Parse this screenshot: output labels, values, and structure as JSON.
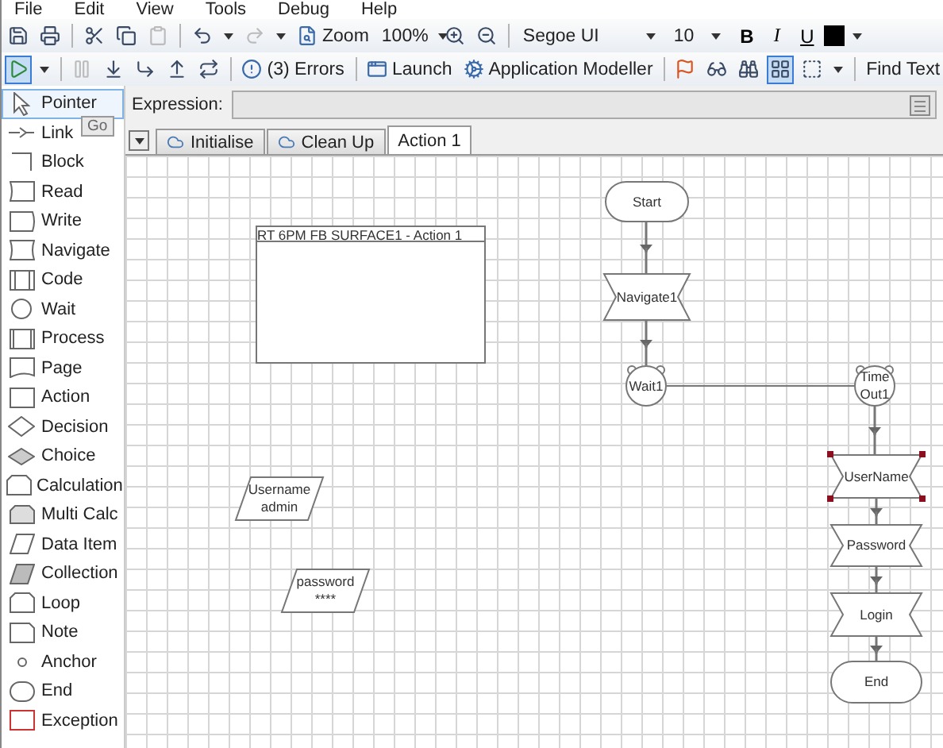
{
  "menu": [
    "File",
    "Edit",
    "View",
    "Tools",
    "Debug",
    "Help"
  ],
  "toolbar_1": [
    {
      "kind": "icon",
      "disabled": false
    },
    {
      "kind": "icon",
      "disabled": false
    },
    {
      "kind": "sep"
    },
    {
      "kind": "icon",
      "disabled": false
    },
    {
      "kind": "icon",
      "disabled": false
    },
    {
      "kind": "icon",
      "disabled": true
    },
    {
      "kind": "sep"
    },
    {
      "kind": "icon",
      "disabled": false
    },
    {
      "kind": "caret"
    },
    {
      "kind": "icon",
      "disabled": true
    },
    {
      "kind": "caret"
    },
    {
      "kind": "button",
      "label": "Zoom"
    },
    {
      "kind": "combo",
      "value": "100%"
    },
    {
      "kind": "icon",
      "disabled": false
    },
    {
      "kind": "icon",
      "disabled": false
    },
    {
      "kind": "sep"
    },
    {
      "kind": "combo",
      "value": "Segoe UI"
    },
    {
      "kind": "combo",
      "value": "10"
    },
    {
      "kind": "text",
      "label": "B"
    },
    {
      "kind": "text",
      "label": "I"
    },
    {
      "kind": "text",
      "label": "U"
    },
    {
      "kind": "swatch",
      "color": "#000000"
    },
    {
      "kind": "caret"
    }
  ],
  "toolbar_2": [
    {
      "kind": "icon",
      "disabled": false,
      "selected": true
    },
    {
      "kind": "caret"
    },
    {
      "kind": "sep"
    },
    {
      "kind": "icon",
      "disabled": true
    },
    {
      "kind": "icon",
      "disabled": false
    },
    {
      "kind": "icon",
      "disabled": false
    },
    {
      "kind": "icon",
      "disabled": false
    },
    {
      "kind": "icon",
      "disabled": false
    },
    {
      "kind": "sep"
    },
    {
      "kind": "button",
      "label": "(3) Errors"
    },
    {
      "kind": "sep"
    },
    {
      "kind": "button",
      "label": "Launch"
    },
    {
      "kind": "button",
      "label": "Application Modeller"
    },
    {
      "kind": "sep"
    },
    {
      "kind": "icon",
      "disabled": false
    },
    {
      "kind": "icon",
      "disabled": false
    },
    {
      "kind": "icon",
      "disabled": false
    },
    {
      "kind": "icon",
      "disabled": false,
      "selected": true
    },
    {
      "kind": "icon",
      "disabled": false
    },
    {
      "kind": "caret"
    },
    {
      "kind": "sep"
    },
    {
      "kind": "button",
      "label": "Find Text"
    }
  ],
  "tooltip": "Go",
  "palette": [
    {
      "kind": "pointer",
      "label": "Pointer",
      "selected": true
    },
    {
      "kind": "link",
      "label": "Link",
      "selected": false
    },
    {
      "kind": "block",
      "label": "Block",
      "selected": false
    },
    {
      "kind": "read",
      "label": "Read",
      "selected": false
    },
    {
      "kind": "write",
      "label": "Write",
      "selected": false
    },
    {
      "kind": "navigate",
      "label": "Navigate",
      "selected": false
    },
    {
      "kind": "code",
      "label": "Code",
      "selected": false
    },
    {
      "kind": "wait",
      "label": "Wait",
      "selected": false
    },
    {
      "kind": "process",
      "label": "Process",
      "selected": false
    },
    {
      "kind": "page",
      "label": "Page",
      "selected": false
    },
    {
      "kind": "action",
      "label": "Action",
      "selected": false
    },
    {
      "kind": "decision",
      "label": "Decision",
      "selected": false
    },
    {
      "kind": "choice",
      "label": "Choice",
      "selected": false
    },
    {
      "kind": "calculation",
      "label": "Calculation",
      "selected": false
    },
    {
      "kind": "multicalc",
      "label": "Multi Calc",
      "selected": false
    },
    {
      "kind": "dataitem",
      "label": "Data Item",
      "selected": false
    },
    {
      "kind": "collection",
      "label": "Collection",
      "selected": false
    },
    {
      "kind": "loop",
      "label": "Loop",
      "selected": false
    },
    {
      "kind": "note",
      "label": "Note",
      "selected": false
    },
    {
      "kind": "anchor",
      "label": "Anchor",
      "selected": false
    },
    {
      "kind": "end",
      "label": "End",
      "selected": false
    },
    {
      "kind": "exception",
      "label": "Exception",
      "selected": false
    }
  ],
  "expression": {
    "label": "Expression:"
  },
  "tabs": [
    {
      "label": "Initialise",
      "icon": true,
      "selected": false
    },
    {
      "label": "Clean Up",
      "icon": true,
      "selected": false
    },
    {
      "label": "Action 1",
      "icon": false,
      "selected": true
    }
  ],
  "canvas": {
    "nodes": [
      {
        "kind": "subsheet",
        "label": "RT 6PM FB SURFACE1 - Action 1",
        "selected": false
      },
      {
        "kind": "terminal",
        "label": "Start",
        "selected": false
      },
      {
        "kind": "navigate",
        "label": "Navigate1",
        "selected": false
      },
      {
        "kind": "wait",
        "label": "Wait1",
        "selected": false
      },
      {
        "kind": "wait",
        "label": "Time Out1",
        "selected": false
      },
      {
        "kind": "navigate",
        "label": "UserName",
        "selected": true
      },
      {
        "kind": "navigate",
        "label": "Password",
        "selected": false
      },
      {
        "kind": "navigate",
        "label": "Login",
        "selected": false
      },
      {
        "kind": "terminal",
        "label": "End",
        "selected": false
      },
      {
        "kind": "data",
        "label": "Username",
        "value": "admin",
        "selected": false
      },
      {
        "kind": "data",
        "label": "password",
        "value": "****",
        "selected": false
      }
    ]
  }
}
